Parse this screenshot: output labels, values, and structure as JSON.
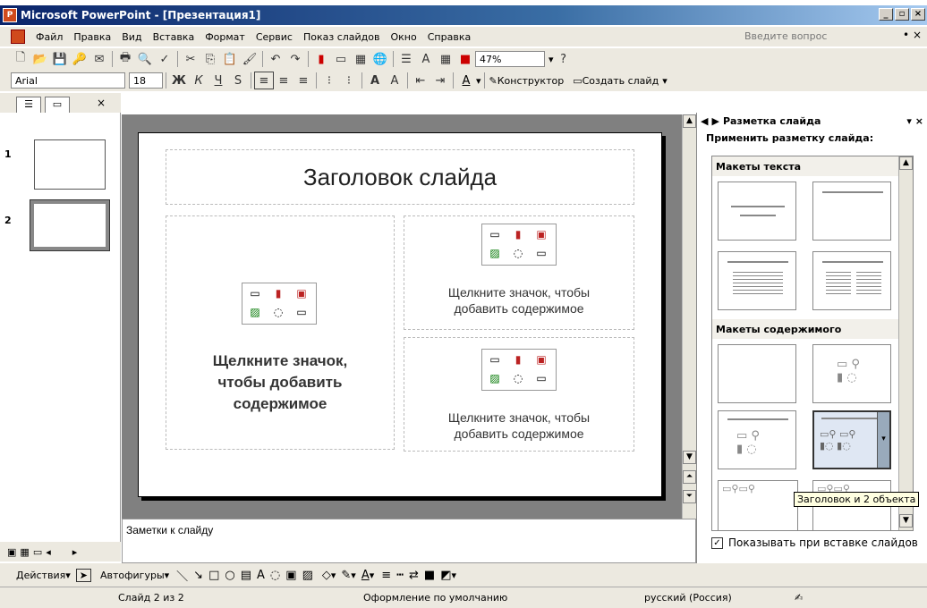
{
  "window": {
    "title": "Microsoft PowerPoint - [Презентация1]"
  },
  "menu": {
    "items": [
      "Файл",
      "Правка",
      "Вид",
      "Вставка",
      "Формат",
      "Сервис",
      "Показ слайдов",
      "Окно",
      "Справка"
    ],
    "help_placeholder": "Введите вопрос"
  },
  "toolbar": {
    "zoom": "47%",
    "font": "Arial",
    "size": "18",
    "bold": "Ж",
    "italic": "К",
    "underline": "Ч",
    "shadow": "S",
    "designer": "Конструктор",
    "new_slide": "Создать слайд"
  },
  "slides": {
    "thumb1": "1",
    "thumb2": "2"
  },
  "slide": {
    "title": "Заголовок слайда",
    "left_text": "Щелкните значок, чтобы добавить содержимое",
    "right_top_text": "Щелкните значок, чтобы добавить содержимое",
    "right_bottom_text": "Щелкните значок, чтобы добавить содержимое"
  },
  "notes": {
    "placeholder": "Заметки к слайду"
  },
  "taskpane": {
    "title": "Разметка слайда",
    "apply_label": "Применить разметку слайда:",
    "section_text": "Макеты текста",
    "section_content": "Макеты содержимого",
    "tooltip": "Заголовок и 2 объекта",
    "show_on_insert": "Показывать при вставке слайдов"
  },
  "drawing": {
    "actions": "Действия",
    "autoshapes": "Автофигуры"
  },
  "status": {
    "slide": "Слайд 2 из 2",
    "design": "Оформление по умолчанию",
    "language": "русский (Россия)"
  }
}
